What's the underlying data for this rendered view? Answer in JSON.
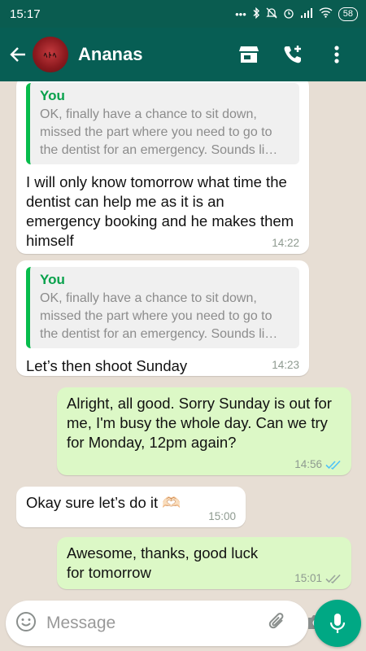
{
  "status_bar": {
    "time": "15:17",
    "battery": "58"
  },
  "header": {
    "contact_name": "Ananas",
    "avatar_text": "ﾍﾄﾍ"
  },
  "messages": [
    {
      "direction": "in",
      "quote_author": "You",
      "quote_text": "OK, finally have a chance to sit down, missed the part where you need to go to the dentist for an emergency.  Sounds li…",
      "text": "I will only know tomorrow what time the dentist can help me as it is an emergency booking and he makes them himself",
      "time": "14:22"
    },
    {
      "direction": "in",
      "quote_author": "You",
      "quote_text": "OK, finally have a chance to sit down, missed the part where you need to go to the dentist for an emergency.  Sounds li…",
      "text": "Let’s then shoot Sunday",
      "time": "14:23"
    },
    {
      "direction": "out",
      "text": "Alright, all good. Sorry Sunday is out for me, I'm busy the whole day. Can we try for Monday, 12pm again?",
      "time": "14:56",
      "status": "read"
    },
    {
      "direction": "in",
      "text": "Okay sure let’s do it 🫶🏻",
      "time": "15:00"
    },
    {
      "direction": "out",
      "text": "Awesome, thanks, good luck for tomorrow",
      "time": "15:01",
      "status": "delivered"
    }
  ],
  "composer": {
    "placeholder": "Message"
  },
  "colors": {
    "header": "#075e54",
    "status_bar": "#0a5c50",
    "outgoing_bubble": "#dcf8c6",
    "incoming_bubble": "#ffffff",
    "read_ticks": "#4fc3f7",
    "accent": "#00a884"
  },
  "icons": {
    "back": "arrow-left-icon",
    "shop": "storefront-icon",
    "call": "add-call-icon",
    "menu": "more-vertical-icon",
    "emoji": "emoji-icon",
    "attach": "paperclip-icon",
    "camera": "camera-icon",
    "mic": "mic-icon"
  }
}
